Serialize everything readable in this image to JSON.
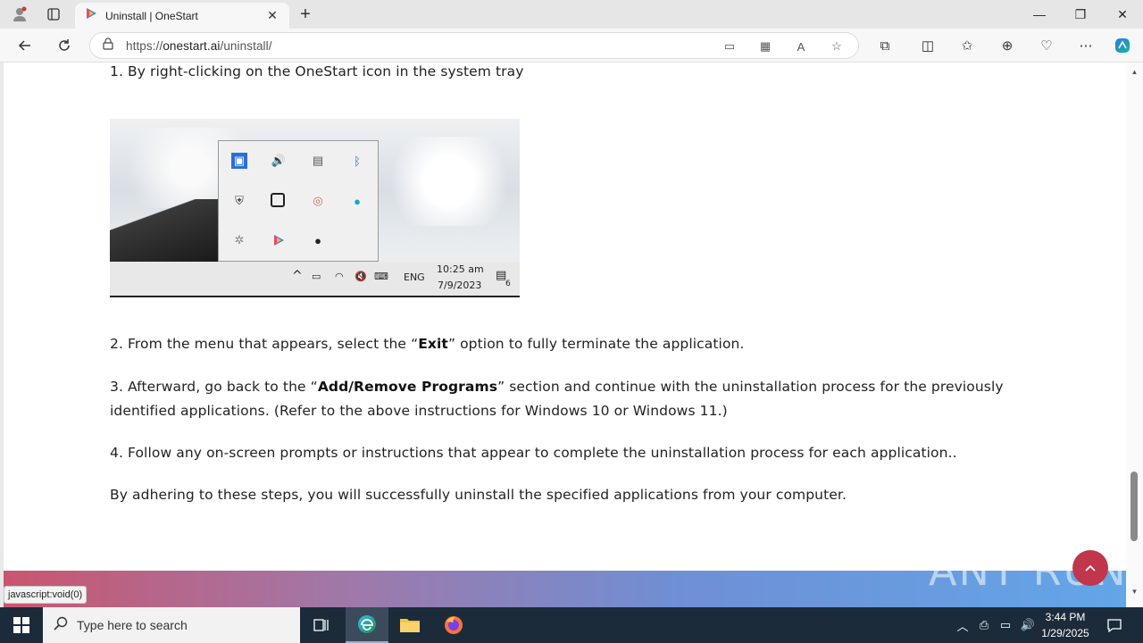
{
  "browser": {
    "tab_title": "Uninstall | OneStart",
    "url_prefix": "https://",
    "url_host": "onestart.ai",
    "url_path": "/uninstall/",
    "status_tip": "javascript:void(0)"
  },
  "article": {
    "step1": "1. By right-clicking on the OneStart icon in the system tray",
    "step2_pre": "2. From the menu that appears, select the “",
    "step2_bold": "Exit",
    "step2_post": "” option to fully terminate the application.",
    "step3_pre": "3. Afterward, go back to the “",
    "step3_bold": "Add/Remove Programs",
    "step3_post": "” section and continue with the uninstallation process for the previously",
    "step3_line2": "identified applications. (Refer to the above instructions for Windows 10 or Windows 11.)",
    "step4": "4. Follow any on-screen prompts or instructions that appear to complete the uninstallation process for each application..",
    "closing": "By adhering to these steps, you will successfully uninstall the specified applications from your computer."
  },
  "embedded_screenshot": {
    "tray_lang": "ENG",
    "tray_time": "10:25 am",
    "tray_date": "7/9/2023",
    "notif_count": "6"
  },
  "watermark": "ANY RUN",
  "taskbar": {
    "search_placeholder": "Type here to search",
    "time": "3:44 PM",
    "date": "1/29/2025"
  },
  "colors": {
    "accent_button": "#c0364a",
    "taskbar": "#1c2b3a"
  }
}
